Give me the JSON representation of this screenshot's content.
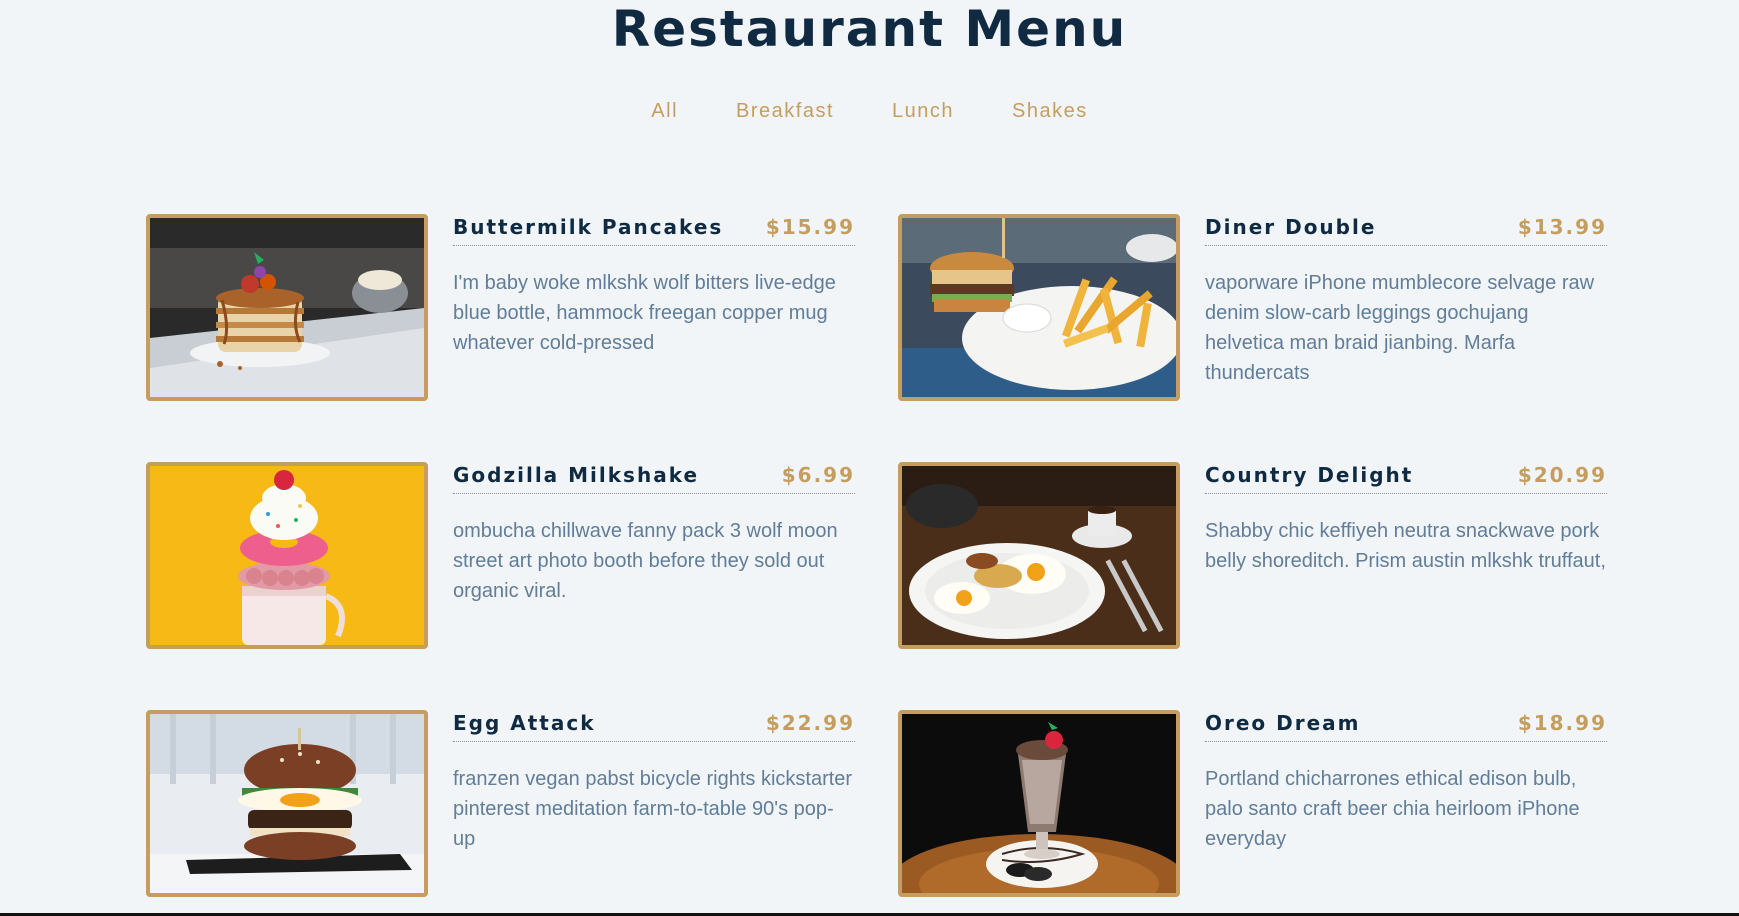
{
  "title": "Restaurant Menu",
  "filters": [
    "All",
    "Breakfast",
    "Lunch",
    "Shakes"
  ],
  "items": [
    {
      "name": "Buttermilk Pancakes",
      "price": "$15.99",
      "desc": "I'm baby woke mlkshk wolf bitters live-edge blue bottle, hammock freegan copper mug whatever cold-pressed",
      "image": "pancakes-photo"
    },
    {
      "name": "Diner Double",
      "price": "$13.99",
      "desc": "vaporware iPhone mumblecore selvage raw denim slow-carb leggings gochujang helvetica man braid jianbing. Marfa thundercats",
      "image": "burger-fries-photo"
    },
    {
      "name": "Godzilla Milkshake",
      "price": "$6.99",
      "desc": "ombucha chillwave fanny pack 3 wolf moon street art photo booth before they sold out organic viral.",
      "image": "milkshake-photo"
    },
    {
      "name": "Country Delight",
      "price": "$20.99",
      "desc": "Shabby chic keffiyeh neutra snackwave pork belly shoreditch. Prism austin mlkshk truffaut,",
      "image": "eggs-breakfast-photo"
    },
    {
      "name": "Egg Attack",
      "price": "$22.99",
      "desc": "franzen vegan pabst bicycle rights kickstarter pinterest meditation farm-to-table 90's pop-up",
      "image": "egg-burger-photo"
    },
    {
      "name": "Oreo Dream",
      "price": "$18.99",
      "desc": "Portland chicharrones ethical edison bulb, palo santo craft beer chia heirloom iPhone everyday",
      "image": "oreo-shake-photo"
    }
  ],
  "colors": {
    "accent": "#c59d5f",
    "heading": "#102a42",
    "text": "#617d98",
    "background": "#f1f5f8"
  }
}
